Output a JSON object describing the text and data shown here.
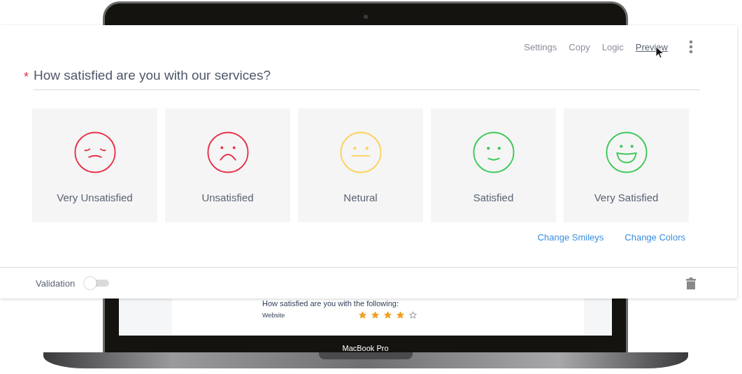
{
  "toolbar": {
    "links": [
      {
        "label": "Settings",
        "selected": false
      },
      {
        "label": "Copy",
        "selected": false
      },
      {
        "label": "Logic",
        "selected": false
      },
      {
        "label": "Preview",
        "selected": true
      }
    ]
  },
  "question": {
    "text": "How satisfied are you with our services?",
    "marker": "*"
  },
  "options": [
    {
      "label": "Very Unsatisfied",
      "kind": "very-unsatisfied",
      "color": "#e8334a"
    },
    {
      "label": "Unsatisfied",
      "kind": "unsatisfied",
      "color": "#e8334a"
    },
    {
      "label": "Netural",
      "kind": "neutral",
      "color": "#fcd25a"
    },
    {
      "label": "Satisfied",
      "kind": "satisfied",
      "color": "#3ec95a"
    },
    {
      "label": "Very Satisfied",
      "kind": "very-satisfied",
      "color": "#3ec95a"
    }
  ],
  "actions": [
    "Change Smileys",
    "Change Colors"
  ],
  "validation": {
    "label": "Validation",
    "on": false
  },
  "device": {
    "label": "MacBook Pro",
    "screen": {
      "heading": "How satisfied are you with the following:",
      "rows": [
        {
          "label": "Website",
          "stars": 4
        }
      ]
    }
  }
}
